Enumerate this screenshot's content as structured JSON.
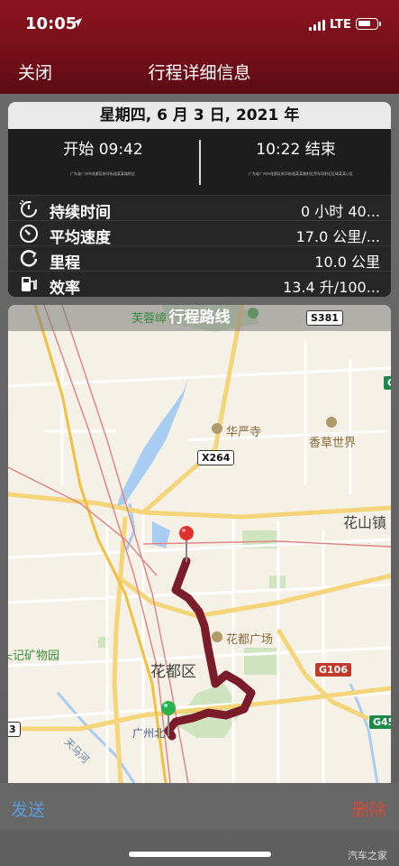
{
  "status_bar": {
    "time": "10:05",
    "network": "LTE",
    "battery_level": 0.7
  },
  "nav": {
    "close": "关闭",
    "title": "行程详细信息"
  },
  "trip": {
    "date": "星期四, 6 月 3 日, 2021 年",
    "start": "开始 09:42",
    "end": "10:22 结束",
    "start_address": "广东省广州市花都区新华街道某某路附近",
    "end_address": "广东省广州市花都区新华街道某某路附近停车场附近区域某某小区"
  },
  "stats": [
    {
      "icon": "timer-icon",
      "label": "持续时间",
      "value": "0 小时 40..."
    },
    {
      "icon": "speedometer-icon",
      "label": "平均速度",
      "value": "17.0 公里/..."
    },
    {
      "icon": "odometer-icon",
      "label": "里程",
      "value": "10.0 公里"
    },
    {
      "icon": "fuel-pump-icon",
      "label": "效率",
      "value": "13.4 升/100..."
    }
  ],
  "map": {
    "title": "行程路线",
    "labels": {
      "furong": "芙蓉嶂",
      "huayan": "华严寺",
      "xiangcao": "香草世界",
      "huashan": "花山镇",
      "huadu_square": "花都广场",
      "huadu_district": "花都区",
      "guangzhou_north": "广州北",
      "kuangyuan": "头记矿物园",
      "tianma": "天马河"
    },
    "roads": {
      "s381": "S381",
      "x264": "X264",
      "g106": "G106",
      "g45": "G45",
      "g23": "3",
      "g_edge": "G"
    },
    "colors": {
      "route": "#7a1c2a",
      "start_pin": "#2bb34a",
      "end_pin": "#e0302a"
    }
  },
  "toolbar": {
    "send": "发送",
    "delete": "删除"
  },
  "watermark": "汽车之家"
}
